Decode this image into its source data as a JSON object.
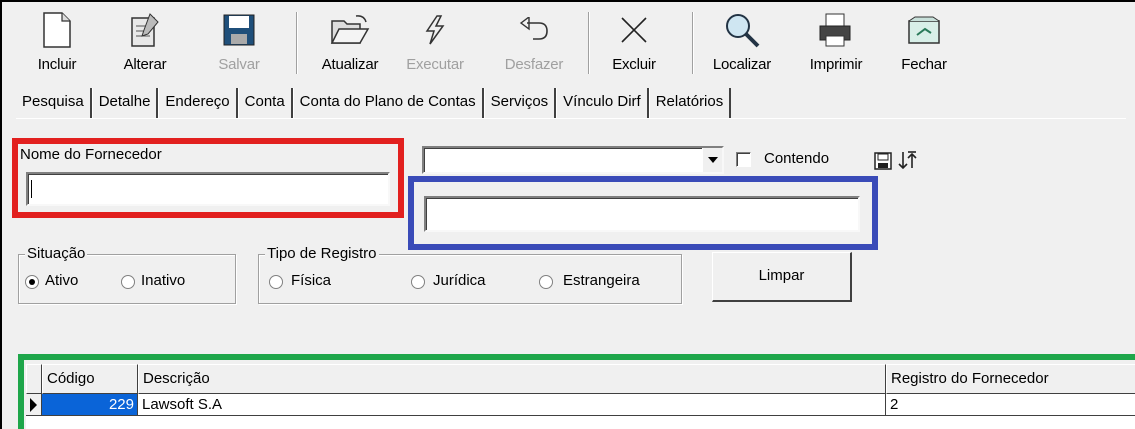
{
  "toolbar": {
    "incluir": "Incluir",
    "alterar": "Alterar",
    "salvar": "Salvar",
    "atualizar": "Atualizar",
    "executar": "Executar",
    "desfazer": "Desfazer",
    "excluir": "Excluir",
    "localizar": "Localizar",
    "imprimir": "Imprimir",
    "fechar": "Fechar"
  },
  "tabs": [
    "Pesquisa",
    "Detalhe",
    "Endereço",
    "Conta",
    "Conta do Plano de Contas",
    "Serviços",
    "Vínculo Dirf",
    "Relatórios"
  ],
  "search": {
    "label": "Nome do Fornecedor",
    "value": "",
    "combo_value": "",
    "contendo_label": "Contendo",
    "contendo_checked": false,
    "secondary_value": ""
  },
  "situacao": {
    "title": "Situação",
    "ativo": "Ativo",
    "inativo": "Inativo",
    "selected": "Ativo"
  },
  "tipo_registro": {
    "title": "Tipo de Registro",
    "fisica": "Física",
    "juridica": "Jurídica",
    "estrangeira": "Estrangeira"
  },
  "limpar_label": "Limpar",
  "grid": {
    "columns": [
      "Código",
      "Descrição",
      "Registro do Fornecedor"
    ],
    "rows": [
      {
        "codigo": "229",
        "descricao": "Lawsoft S.A",
        "registro": "2"
      }
    ]
  },
  "colors": {
    "highlight_red": "#e2201f",
    "highlight_blue": "#3a4bb8",
    "highlight_green": "#1ea64a",
    "selection": "#0a64d8"
  }
}
